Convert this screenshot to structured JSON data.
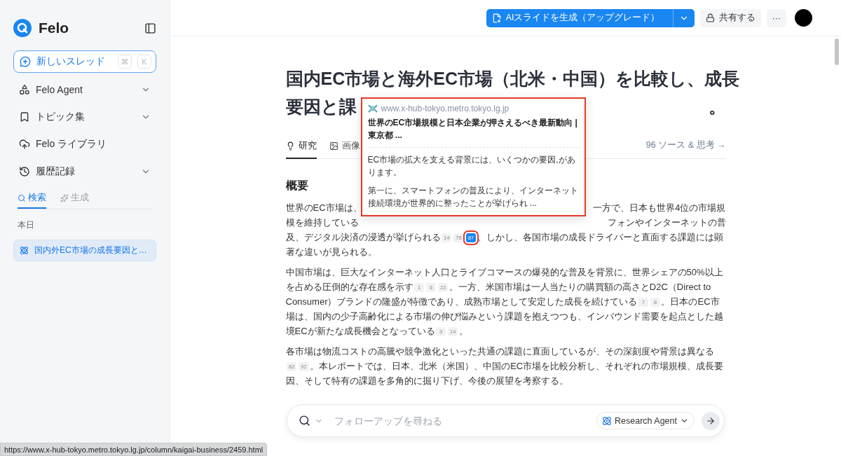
{
  "sidebar": {
    "brand": "Felo",
    "new_thread": {
      "label": "新しいスレッド",
      "keys": [
        "⌘",
        "K"
      ]
    },
    "nav": [
      {
        "label": "Felo Agent",
        "kind": "agent",
        "expandable": true
      },
      {
        "label": "トピック集",
        "kind": "topics",
        "expandable": true
      },
      {
        "label": "Felo ライブラリ",
        "kind": "library",
        "expandable": false
      },
      {
        "label": "履歴記録",
        "kind": "history",
        "expandable": true
      }
    ],
    "tabs": [
      {
        "label": "検索",
        "kind": "search",
        "selected": true
      },
      {
        "label": "生成",
        "kind": "generate",
        "selected": false
      }
    ],
    "section": "本日",
    "history": [
      {
        "label": "国内外EC市場の成長要因と…",
        "selected": true
      }
    ]
  },
  "header": {
    "primary_button": "AIスライドを生成（アップグレード）",
    "share_button": "共有する",
    "more_button": "···"
  },
  "article": {
    "title_lines": [
      {
        "left": "国内EC市場と海外EC市場（北米・中国）を比較し、成長"
      },
      {
        "left": "要因と課",
        "right": "。"
      }
    ],
    "tabs": [
      {
        "label": "研究",
        "kind": "research",
        "selected": true
      },
      {
        "label": "画像",
        "kind": "images",
        "selected": false
      }
    ],
    "sources_link": "96 ソース & 思考 →",
    "heading": "概要",
    "paragraphs": [
      {
        "split_lines": [
          {
            "left": "世界のEC市場は、",
            "right": "一方で、日本も世界4位の市場規"
          },
          {
            "left": "模を維持している",
            "right": "フォンやインターネットの普"
          }
        ],
        "segments": [
          {
            "kind": "text",
            "text": "及、デジタル決済の浸透が挙げられる"
          },
          {
            "kind": "cite",
            "label": "14",
            "selected": false
          },
          {
            "kind": "cite",
            "label": "75",
            "selected": false
          },
          {
            "kind": "cite",
            "label": "87",
            "selected": true
          },
          {
            "kind": "text",
            "text": "。しかし、各国市場の成長ドライバーと直面する課題には顕著な違いが見られる。"
          }
        ]
      },
      {
        "segments": [
          {
            "kind": "text",
            "text": "中国市場は、巨大なインターネット人口とライブコマースの爆発的な普及を背景に、世界シェアの50%以上を占める圧倒的な存在感を示す"
          },
          {
            "kind": "cite",
            "label": "1",
            "selected": false
          },
          {
            "kind": "cite",
            "label": "6",
            "selected": false
          },
          {
            "kind": "cite",
            "label": "22",
            "selected": false
          },
          {
            "kind": "text",
            "text": "。一方、米国市場は一人当たりの購買額の高さとD2C（Direct to Consumer）ブランドの隆盛が特徴であり、成熟市場として安定した成長を続けている"
          },
          {
            "kind": "cite",
            "label": "7",
            "selected": false
          },
          {
            "kind": "cite",
            "label": "8",
            "selected": false
          },
          {
            "kind": "text",
            "text": "。日本のEC市場は、国内の少子高齢化による市場の伸び悩みという課題を抱えつつも、インバウンド需要を起点とした越境ECが新たな成長機会となっている"
          },
          {
            "kind": "cite",
            "label": "3",
            "selected": false
          },
          {
            "kind": "cite",
            "label": "14",
            "selected": false
          },
          {
            "kind": "text",
            "text": "。"
          }
        ]
      },
      {
        "segments": [
          {
            "kind": "text",
            "text": "各市場は物流コストの高騰や競争激化といった共通の課題に直面しているが、その深刻度や背景は異なる"
          },
          {
            "kind": "cite",
            "label": "82",
            "selected": false
          },
          {
            "kind": "cite",
            "label": "92",
            "selected": false
          },
          {
            "kind": "text",
            "text": "。本レポートでは、日本、北米（米国）、中国のEC市場を比較分析し、それぞれの市場規模、成長要因、そして特有の課題を多角的に掘り下げ、今後の展望を考察する。"
          }
        ]
      }
    ]
  },
  "popover": {
    "domain": "www.x-hub-tokyo.metro.tokyo.lg.jp",
    "title": "世界のEC市場規模と日本企業が押さえるべき最新動向 | 東京都 ...",
    "excerpts": [
      "EC市場の拡大を支える背景には、いくつかの要因,があります。",
      "第一に、スマートフォンの普及により、インターネット接続環境が世界的に整ったことが挙げられ ..."
    ]
  },
  "composer": {
    "placeholder": "フォローアップを尋ねる",
    "agent": "Research Agent"
  },
  "status_url": "https://www.x-hub-tokyo.metro.tokyo.lg.jp/column/kaigai-business/2459.html"
}
